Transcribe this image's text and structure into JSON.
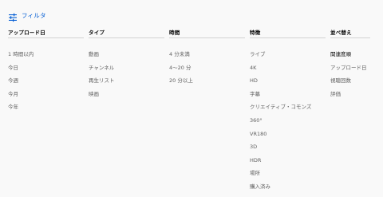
{
  "filter": {
    "label": "フィルタ",
    "icon": "tune-icon",
    "accent_color": "#065fd4"
  },
  "columns": [
    {
      "header": "アップロード日",
      "items": [
        "1 時間以内",
        "今日",
        "今週",
        "今月",
        "今年"
      ]
    },
    {
      "header": "タイプ",
      "items": [
        "動画",
        "チャンネル",
        "再生リスト",
        "映画"
      ]
    },
    {
      "header": "時間",
      "items": [
        "4 分未満",
        "4～20 分",
        "20 分以上"
      ]
    },
    {
      "header": "特徴",
      "items": [
        "ライブ",
        "4K",
        "HD",
        "字幕",
        "クリエイティブ・コモンズ",
        "360°",
        "VR180",
        "3D",
        "HDR",
        "場所",
        "購入済み"
      ]
    },
    {
      "header": "並べ替え",
      "items": [
        "関連度順",
        "アップロード日",
        "視聴回数",
        "評価"
      ],
      "selected_index": 0
    }
  ]
}
